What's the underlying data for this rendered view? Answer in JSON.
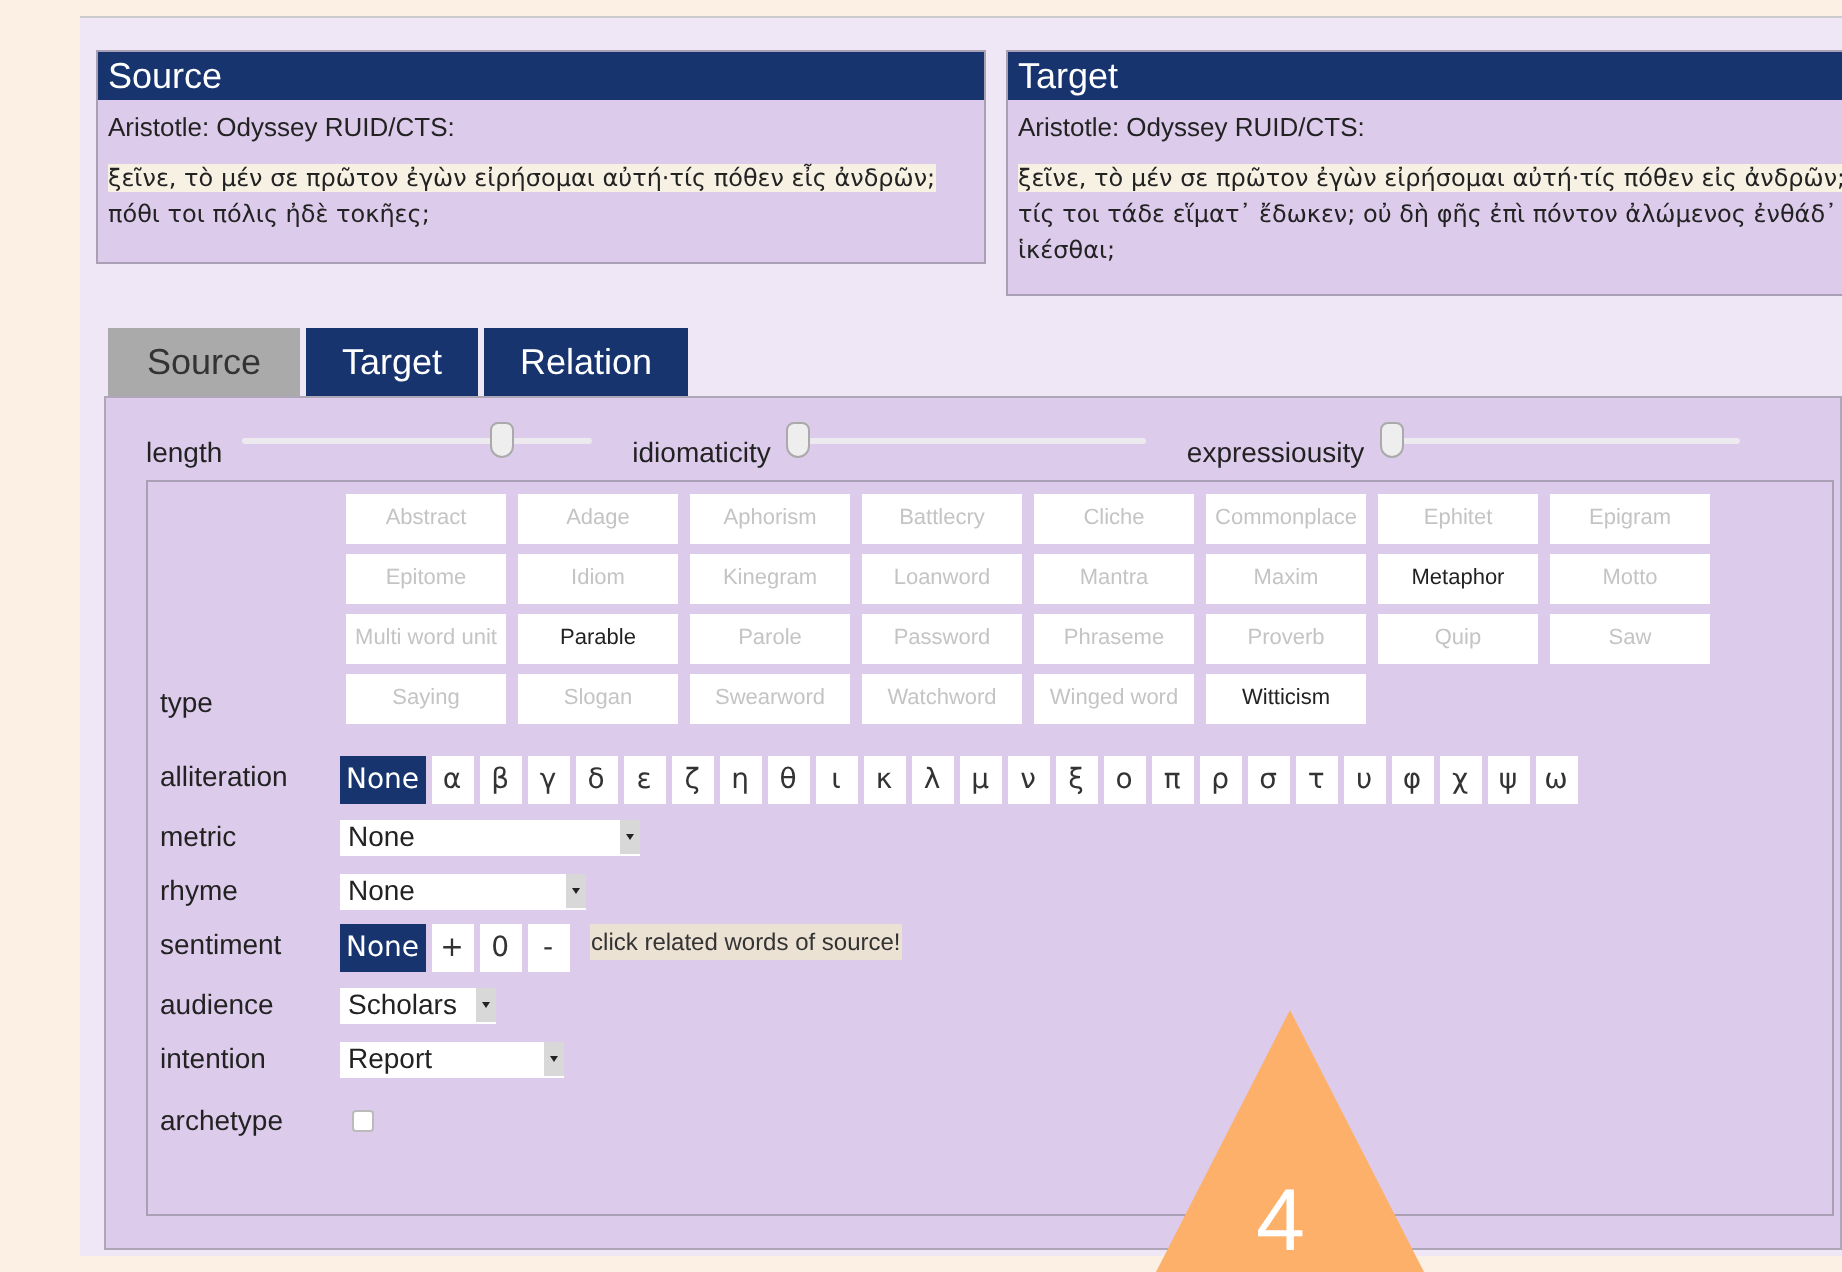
{
  "passages": [
    {
      "title": "Source",
      "reference": "Aristotle:  Odyssey RUID/CTS:",
      "segments": [
        {
          "text": "ξεῖνε, τὸ μέν σε πρῶτον ἐγὼν εἰρήσομαι αὐτή·τίς πόθεν εἶς ἀνδρῶν;",
          "highlighted": true
        },
        {
          "text": " πόθι τοι πόλις ἠδὲ τοκῆες;",
          "highlighted": false
        }
      ]
    },
    {
      "title": "Target",
      "reference": "Aristotle:  Odyssey RUID/CTS:",
      "segments": [
        {
          "text": "ξεῖνε, τὸ μέν σε πρῶτον ἐγὼν εἰρήσομαι αὐτή·τίς πόθεν εἰς ἀνδρῶν;",
          "highlighted": true
        },
        {
          "text": " τίς τοι τάδε εἵματ᾽ ἔδωκεν; οὐ δὴ φῆς ἐπὶ πόντον ἀλώμενος ἐνθάδ᾽ ἱκέσθαι;",
          "highlighted": false
        }
      ]
    }
  ],
  "tabs": [
    {
      "label": "Source",
      "selected": true
    },
    {
      "label": "Target",
      "selected": false
    },
    {
      "label": "Relation",
      "selected": false
    }
  ],
  "sliders": [
    {
      "label": "length",
      "level": 0.74
    },
    {
      "label": "idiomaticity",
      "level": 0.02
    },
    {
      "label": "expressiousity",
      "level": 0.02
    }
  ],
  "type": {
    "label": "type",
    "options": [
      {
        "label": "Abstract",
        "selected": false
      },
      {
        "label": "Adage",
        "selected": false
      },
      {
        "label": "Aphorism",
        "selected": false
      },
      {
        "label": "Battlecry",
        "selected": false
      },
      {
        "label": "Cliche",
        "selected": false
      },
      {
        "label": "Commonplace",
        "selected": false
      },
      {
        "label": "Ephitet",
        "selected": false
      },
      {
        "label": "Epigram",
        "selected": false
      },
      {
        "label": "Epitome",
        "selected": false
      },
      {
        "label": "Idiom",
        "selected": false
      },
      {
        "label": "Kinegram",
        "selected": false
      },
      {
        "label": "Loanword",
        "selected": false
      },
      {
        "label": "Mantra",
        "selected": false
      },
      {
        "label": "Maxim",
        "selected": false
      },
      {
        "label": "Metaphor",
        "selected": true
      },
      {
        "label": "Motto",
        "selected": false
      },
      {
        "label": "Multi word unit",
        "selected": false
      },
      {
        "label": "Parable",
        "selected": true
      },
      {
        "label": "Parole",
        "selected": false
      },
      {
        "label": "Password",
        "selected": false
      },
      {
        "label": "Phraseme",
        "selected": false
      },
      {
        "label": "Proverb",
        "selected": false
      },
      {
        "label": "Quip",
        "selected": false
      },
      {
        "label": "Saw",
        "selected": false
      },
      {
        "label": "Saying",
        "selected": false
      },
      {
        "label": "Slogan",
        "selected": false
      },
      {
        "label": "Swearword",
        "selected": false
      },
      {
        "label": "Watchword",
        "selected": false
      },
      {
        "label": "Winged word",
        "selected": false
      },
      {
        "label": "Witticism",
        "selected": true
      }
    ]
  },
  "fields": [
    {
      "kind": "toggles",
      "label": "alliteration",
      "options": [
        {
          "label": "None",
          "selected": true
        },
        {
          "label": "α",
          "selected": false
        },
        {
          "label": "β",
          "selected": false
        },
        {
          "label": "γ",
          "selected": false
        },
        {
          "label": "δ",
          "selected": false
        },
        {
          "label": "ε",
          "selected": false
        },
        {
          "label": "ζ",
          "selected": false
        },
        {
          "label": "η",
          "selected": false
        },
        {
          "label": "θ",
          "selected": false
        },
        {
          "label": "ι",
          "selected": false
        },
        {
          "label": "κ",
          "selected": false
        },
        {
          "label": "λ",
          "selected": false
        },
        {
          "label": "μ",
          "selected": false
        },
        {
          "label": "ν",
          "selected": false
        },
        {
          "label": "ξ",
          "selected": false
        },
        {
          "label": "ο",
          "selected": false
        },
        {
          "label": "π",
          "selected": false
        },
        {
          "label": "ρ",
          "selected": false
        },
        {
          "label": "σ",
          "selected": false
        },
        {
          "label": "τ",
          "selected": false
        },
        {
          "label": "υ",
          "selected": false
        },
        {
          "label": "φ",
          "selected": false
        },
        {
          "label": "χ",
          "selected": false
        },
        {
          "label": "ψ",
          "selected": false
        },
        {
          "label": "ω",
          "selected": false
        }
      ]
    },
    {
      "kind": "select",
      "label": "metric",
      "value": "None"
    },
    {
      "kind": "select",
      "label": "rhyme",
      "value": "None"
    },
    {
      "kind": "toggles",
      "label": "sentiment",
      "options": [
        {
          "label": "None",
          "selected": true
        },
        {
          "label": "+",
          "selected": false
        },
        {
          "label": "0",
          "selected": false
        },
        {
          "label": "-",
          "selected": false
        }
      ],
      "hint": "click related words of source!"
    },
    {
      "kind": "select",
      "label": "audience",
      "value": "Scholars"
    },
    {
      "kind": "select",
      "label": "intention",
      "value": "Report"
    },
    {
      "kind": "checkbox",
      "label": "archetype",
      "checked": false
    }
  ],
  "marker": {
    "label": "4"
  }
}
